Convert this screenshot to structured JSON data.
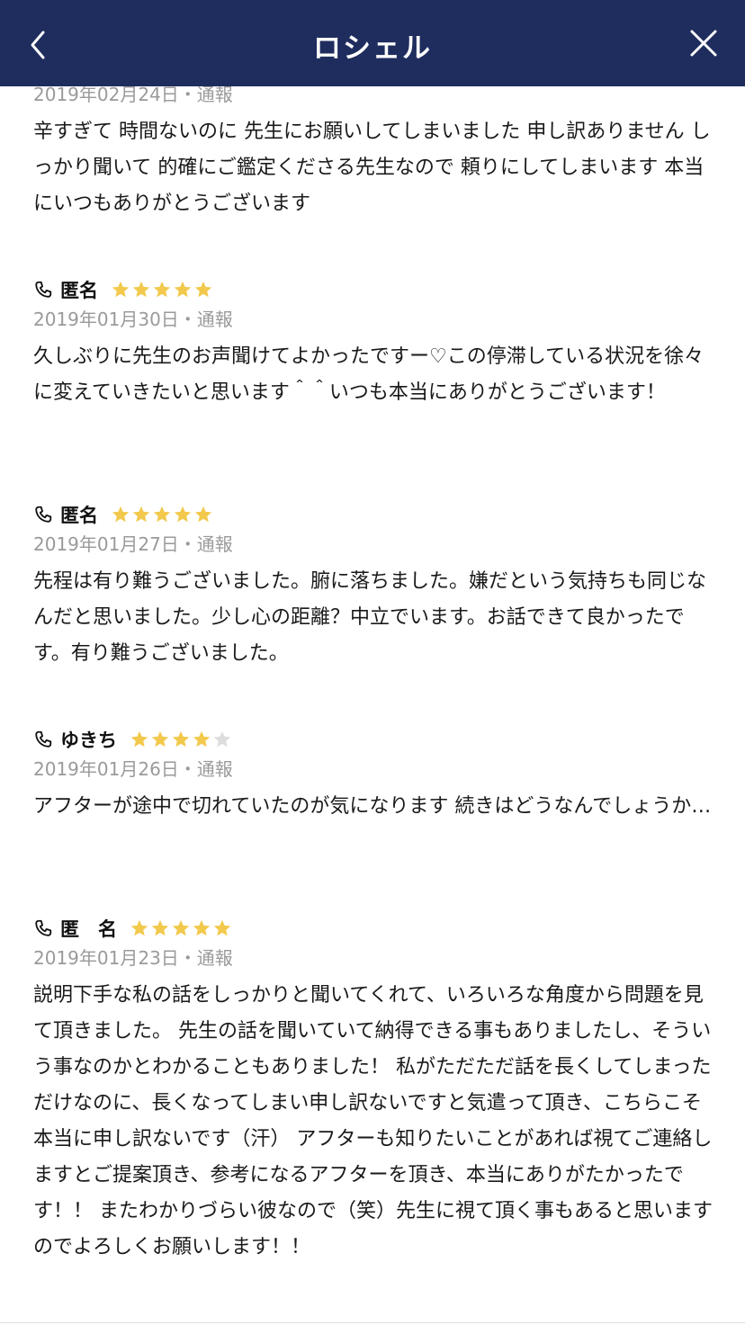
{
  "header": {
    "title": "ロシェル"
  },
  "colors": {
    "header_bg": "#1f2d5e",
    "star_on": "#f2c94c",
    "star_off": "#dddddd"
  },
  "reviews": [
    {
      "name": "",
      "date": "2019年02月24日",
      "report": "・通報",
      "body": "辛すぎて 時間ないのに 先生にお願いしてしまいました 申し訳ありません しっかり聞いて 的確にご鑑定くださる先生なので 頼りにしてしまいます 本当にいつもありがとうございます"
    },
    {
      "name": "匿名",
      "rating": 5,
      "date": "2019年01月30日",
      "report": "・通報",
      "body": "久しぶりに先生のお声聞けてよかったですー♡この停滞している状況を徐々に変えていきたいと思います＾＾いつも本当にありがとうございます！"
    },
    {
      "name": "匿名",
      "rating": 5,
      "date": "2019年01月27日",
      "report": "・通報",
      "body": "先程は有り難うございました。腑に落ちました。嫌だという気持ちも同じなんだと思いました。少し心の距離？中立でいます。お話できて良かったです。有り難うございました。"
    },
    {
      "name": "ゆきち",
      "rating": 4,
      "date": "2019年01月26日",
      "report": "・通報",
      "body": "アフターが途中で切れていたのが気になります 続きはどうなんでしょうか…"
    },
    {
      "name": "匿　名",
      "rating": 5,
      "date": "2019年01月23日",
      "report": "・通報",
      "body": "説明下手な私の話をしっかりと聞いてくれて、いろいろな角度から問題を見て頂きました。 先生の話を聞いていて納得できる事もありましたし、そういう事なのかとわかることもありました！ 私がただただ話を長くしてしまっただけなのに、長くなってしまい申し訳ないですと気遣って頂き、こちらこそ本当に申し訳ないです（汗） アフターも知りたいことがあれば視てご連絡しますとご提案頂き、参考になるアフターを頂き、本当にありがたかったです！！ またわかりづらい彼なので（笑）先生に視て頂く事もあると思いますのでよろしくお願いします！！"
    }
  ]
}
